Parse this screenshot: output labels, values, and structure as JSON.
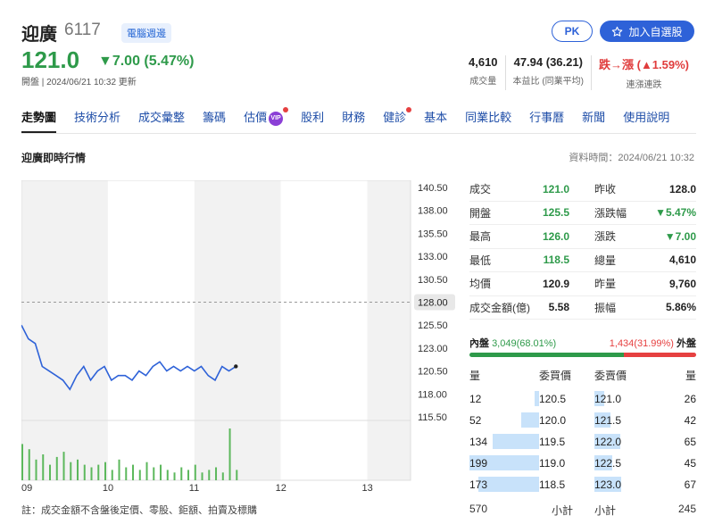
{
  "header": {
    "name": "迎廣",
    "code": "6117",
    "badge": "電腦週邊",
    "price": "121.0",
    "change": "▼7.00 (5.47%)",
    "subline": "開盤 | 2024/06/21 10:32 更新",
    "pk_label": "PK",
    "watch_label": "加入自選股",
    "metrics": [
      {
        "value": "4,610",
        "label": "成交量"
      },
      {
        "value": "47.94 (36.21)",
        "label": "本益比 (同業平均)"
      },
      {
        "value": "跌→漲 (▲1.59%)",
        "label": "連漲連跌"
      }
    ]
  },
  "tabs": [
    "走勢圖",
    "技術分析",
    "成交彙整",
    "籌碼",
    "估價",
    "股利",
    "財務",
    "健診",
    "基本",
    "同業比較",
    "行事曆",
    "新聞",
    "使用說明"
  ],
  "vip_label": "VIP",
  "section": {
    "title": "迎廣即時行情",
    "data_time": "資料時間：2024/06/21 10:32"
  },
  "chart_data": {
    "type": "line",
    "x_ticks": [
      "09",
      "10",
      "11",
      "12",
      "13"
    ],
    "y_ticks": [
      140.5,
      138.0,
      135.5,
      133.0,
      130.5,
      128.0,
      125.5,
      123.0,
      120.5,
      118.0,
      115.5
    ],
    "y_tick_labels": [
      "140.50",
      "138.00",
      "135.50",
      "133.00",
      "130.50",
      "128.00",
      "125.50",
      "123.00",
      "120.50",
      "118.00",
      "115.50"
    ],
    "ylim": [
      115.5,
      140.5
    ],
    "reference_price": 128.0,
    "reference_label": "128.00",
    "series": [
      {
        "x": [
          0,
          3,
          6,
          9,
          12,
          15,
          18,
          21,
          24,
          27,
          30,
          33,
          36,
          39,
          42,
          45,
          48,
          51,
          54,
          57,
          60,
          63,
          66,
          69,
          72,
          75,
          78,
          81,
          84,
          87,
          90,
          93
        ],
        "y": [
          125.5,
          124.0,
          123.5,
          121.0,
          120.5,
          120.0,
          119.5,
          118.5,
          120.0,
          121.0,
          119.5,
          120.5,
          121.0,
          119.5,
          120.0,
          120.0,
          119.5,
          120.5,
          120.0,
          121.0,
          121.5,
          120.5,
          121.0,
          120.5,
          121.0,
          120.5,
          121.0,
          120.0,
          119.5,
          121.0,
          120.5,
          121.0
        ]
      }
    ],
    "volume": [
      70,
      60,
      40,
      50,
      30,
      45,
      55,
      35,
      40,
      30,
      25,
      30,
      35,
      20,
      40,
      25,
      30,
      20,
      35,
      25,
      30,
      20,
      15,
      25,
      20,
      30,
      15,
      20,
      25,
      15,
      100,
      20
    ]
  },
  "quote": {
    "rows": [
      {
        "l": "成交",
        "v": "121.0",
        "vc": "green",
        "l2": "昨收",
        "v2": "128.0",
        "v2c": ""
      },
      {
        "l": "開盤",
        "v": "125.5",
        "vc": "green",
        "l2": "漲跌幅",
        "v2": "▼5.47%",
        "v2c": "green"
      },
      {
        "l": "最高",
        "v": "126.0",
        "vc": "green",
        "l2": "漲跌",
        "v2": "▼7.00",
        "v2c": "green"
      },
      {
        "l": "最低",
        "v": "118.5",
        "vc": "green",
        "l2": "總量",
        "v2": "4,610",
        "v2c": ""
      },
      {
        "l": "均價",
        "v": "120.9",
        "vc": "",
        "l2": "昨量",
        "v2": "9,760",
        "v2c": ""
      },
      {
        "l": "成交金額(億)",
        "v": "5.58",
        "vc": "",
        "l2": "振幅",
        "v2": "5.86%",
        "v2c": ""
      }
    ]
  },
  "bidask": {
    "inner_label": "內盤",
    "inner_value": "3,049(68.01%)",
    "outer_value": "1,434(31.99%)",
    "outer_label": "外盤",
    "inner_ratio": 0.6801,
    "colors": {
      "inner": "#2e9a4a",
      "outer": "#e64040"
    }
  },
  "book": {
    "head": {
      "qty": "量",
      "bid": "委買價",
      "ask": "委賣價",
      "qty2": "量"
    },
    "bids": [
      {
        "qty": "12",
        "price": "120.5",
        "fill": 0.06
      },
      {
        "qty": "52",
        "price": "120.0",
        "fill": 0.26
      },
      {
        "qty": "134",
        "price": "119.5",
        "fill": 0.67
      },
      {
        "qty": "199",
        "price": "119.0",
        "fill": 1.0
      },
      {
        "qty": "173",
        "price": "118.5",
        "fill": 0.87
      }
    ],
    "asks": [
      {
        "qty": "26",
        "price": "121.0",
        "fill": 0.2
      },
      {
        "qty": "42",
        "price": "121.5",
        "fill": 0.32
      },
      {
        "qty": "65",
        "price": "122.0",
        "fill": 0.5
      },
      {
        "qty": "45",
        "price": "122.5",
        "fill": 0.35
      },
      {
        "qty": "67",
        "price": "123.0",
        "fill": 0.52
      }
    ],
    "bid_total": "570",
    "bid_total_label": "小計",
    "ask_total_label": "小計",
    "ask_total": "245"
  },
  "footnote": "註：成交金額不含盤後定價、零股、鉅額、拍賣及標購"
}
